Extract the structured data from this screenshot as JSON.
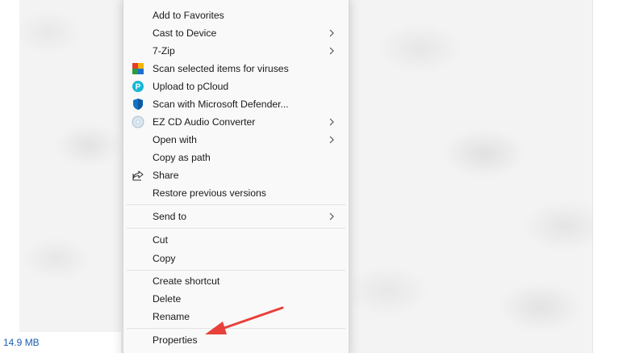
{
  "menu": {
    "items": [
      {
        "label": "Add to Favorites",
        "icon": "",
        "submenu": false
      },
      {
        "label": "Cast to Device",
        "icon": "",
        "submenu": true
      },
      {
        "label": "7-Zip",
        "icon": "",
        "submenu": true
      },
      {
        "label": "Scan selected items for viruses",
        "icon": "avg-shield-icon",
        "submenu": false
      },
      {
        "label": "Upload to pCloud",
        "icon": "pcloud-icon",
        "submenu": false
      },
      {
        "label": "Scan with Microsoft Defender...",
        "icon": "defender-shield-icon",
        "submenu": false
      },
      {
        "label": "EZ CD Audio Converter",
        "icon": "cd-icon",
        "submenu": true
      },
      {
        "label": "Open with",
        "icon": "",
        "submenu": true
      },
      {
        "label": "Copy as path",
        "icon": "",
        "submenu": false
      },
      {
        "label": "Share",
        "icon": "share-icon",
        "submenu": false
      },
      {
        "label": "Restore previous versions",
        "icon": "",
        "submenu": false
      },
      {
        "label": "Send to",
        "icon": "",
        "submenu": true
      },
      {
        "label": "Cut",
        "icon": "",
        "submenu": false
      },
      {
        "label": "Copy",
        "icon": "",
        "submenu": false
      },
      {
        "label": "Create shortcut",
        "icon": "",
        "submenu": false
      },
      {
        "label": "Delete",
        "icon": "",
        "submenu": false
      },
      {
        "label": "Rename",
        "icon": "",
        "submenu": false
      },
      {
        "label": "Properties",
        "icon": "",
        "submenu": false
      }
    ]
  },
  "status": {
    "size": "14.9 MB"
  },
  "annotation": {
    "arrow_color": "#e8403a"
  },
  "colors": {
    "menu_bg": "#f9f9f9",
    "status_text": "#1b5fb0"
  }
}
